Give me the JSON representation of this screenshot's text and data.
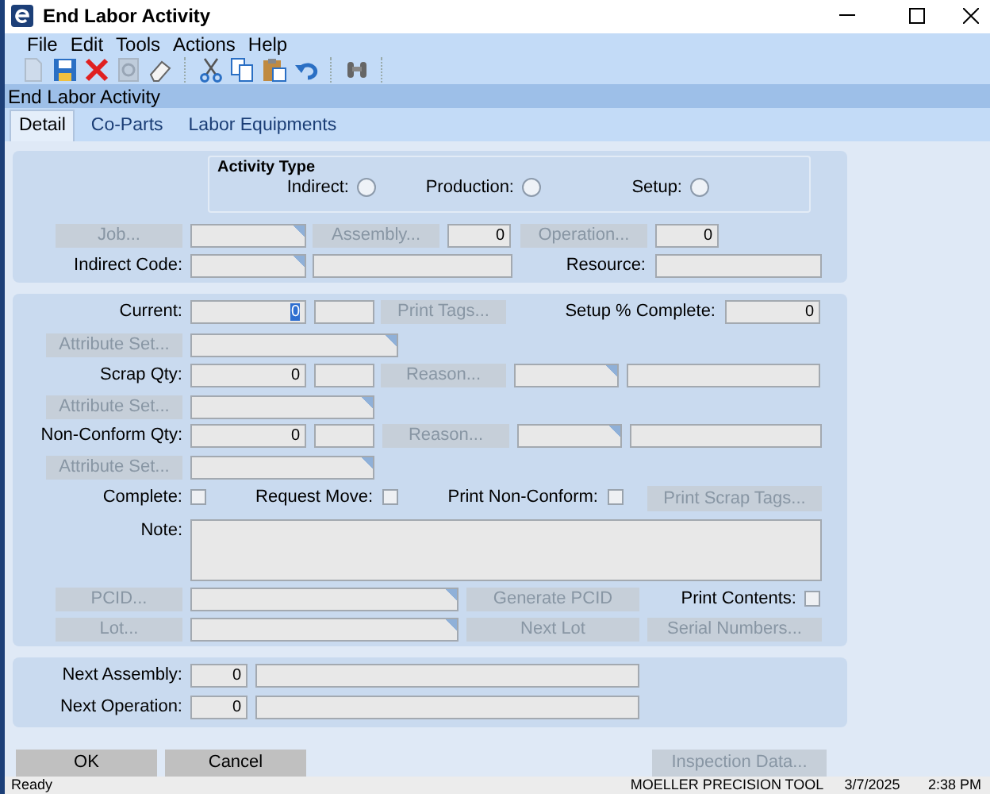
{
  "window": {
    "title": "End Labor Activity"
  },
  "menu": [
    "File",
    "Edit",
    "Tools",
    "Actions",
    "Help"
  ],
  "toolbar": [
    {
      "kind": "new",
      "disabled": true
    },
    {
      "kind": "save",
      "disabled": false
    },
    {
      "kind": "delete",
      "disabled": false
    },
    {
      "kind": "refresh",
      "disabled": true
    },
    {
      "kind": "clear",
      "disabled": false
    },
    {
      "kind": "sep"
    },
    {
      "kind": "cut",
      "disabled": false
    },
    {
      "kind": "copy",
      "disabled": false
    },
    {
      "kind": "paste",
      "disabled": false
    },
    {
      "kind": "undo",
      "disabled": false
    },
    {
      "kind": "sep"
    },
    {
      "kind": "find",
      "disabled": false
    },
    {
      "kind": "sep"
    }
  ],
  "form_title": "End Labor Activity",
  "tabs": [
    {
      "label": "Detail",
      "selected": true
    },
    {
      "label": "Co-Parts",
      "selected": false
    },
    {
      "label": "Labor Equipments",
      "selected": false
    }
  ],
  "activity_type": {
    "title": "Activity Type",
    "options": [
      {
        "label": "Indirect:",
        "selected": false
      },
      {
        "label": "Production:",
        "selected": false
      },
      {
        "label": "Setup:",
        "selected": false
      }
    ]
  },
  "panels": [
    {
      "rows": [
        {
          "items": [
            {
              "kind": "button",
              "label": "Job...",
              "disabled": true
            },
            {
              "kind": "field",
              "value": "",
              "lookup": true
            },
            {
              "kind": "button",
              "label": "Assembly...",
              "disabled": true
            },
            {
              "kind": "field",
              "value": "0",
              "lookup": false
            },
            {
              "kind": "button",
              "label": "Operation...",
              "disabled": true
            },
            {
              "kind": "field",
              "value": "0",
              "lookup": false
            }
          ]
        },
        {
          "items": [
            {
              "kind": "label",
              "label": "Indirect Code:"
            },
            {
              "kind": "field",
              "value": "",
              "lookup": true
            },
            {
              "kind": "field",
              "value": "",
              "lookup": false
            },
            {
              "kind": "label",
              "label": "Resource:"
            },
            {
              "kind": "field",
              "value": "",
              "lookup": false
            }
          ]
        }
      ]
    },
    {
      "rows": [
        {
          "items": [
            {
              "kind": "label",
              "label": "Current:"
            },
            {
              "kind": "field",
              "value": "0",
              "lookup": false,
              "highlighted": true
            },
            {
              "kind": "field",
              "value": "",
              "lookup": false
            },
            {
              "kind": "button",
              "label": "Print Tags...",
              "disabled": true
            },
            {
              "kind": "label",
              "label": "Setup % Complete:"
            },
            {
              "kind": "field",
              "value": "0",
              "lookup": false
            }
          ]
        },
        {
          "items": [
            {
              "kind": "button",
              "label": "Attribute Set...",
              "disabled": true
            },
            {
              "kind": "field",
              "value": "",
              "lookup": true
            }
          ]
        },
        {
          "items": [
            {
              "kind": "label",
              "label": "Scrap Qty:"
            },
            {
              "kind": "field",
              "value": "0",
              "lookup": false
            },
            {
              "kind": "field",
              "value": "",
              "lookup": false
            },
            {
              "kind": "button",
              "label": "Reason...",
              "disabled": true
            },
            {
              "kind": "field",
              "value": "",
              "lookup": true
            },
            {
              "kind": "field",
              "value": "",
              "lookup": false
            }
          ]
        },
        {
          "items": [
            {
              "kind": "button",
              "label": "Attribute Set...",
              "disabled": true
            },
            {
              "kind": "field",
              "value": "",
              "lookup": true
            }
          ]
        },
        {
          "items": [
            {
              "kind": "label",
              "label": "Non-Conform Qty:"
            },
            {
              "kind": "field",
              "value": "0",
              "lookup": false
            },
            {
              "kind": "field",
              "value": "",
              "lookup": false
            },
            {
              "kind": "button",
              "label": "Reason...",
              "disabled": true
            },
            {
              "kind": "field",
              "value": "",
              "lookup": true
            },
            {
              "kind": "field",
              "value": "",
              "lookup": false
            }
          ]
        },
        {
          "items": [
            {
              "kind": "button",
              "label": "Attribute Set...",
              "disabled": true
            },
            {
              "kind": "field",
              "value": "",
              "lookup": true
            }
          ]
        },
        {
          "items": [
            {
              "kind": "label",
              "label": "Complete:"
            },
            {
              "kind": "checkbox",
              "checked": false
            },
            {
              "kind": "label",
              "label": "Request Move:"
            },
            {
              "kind": "checkbox",
              "checked": false
            },
            {
              "kind": "label",
              "label": "Print Non-Conform:"
            },
            {
              "kind": "checkbox",
              "checked": false
            },
            {
              "kind": "button",
              "label": "Print Scrap Tags...",
              "disabled": true
            }
          ]
        },
        {
          "items": [
            {
              "kind": "label",
              "label": "Note:"
            },
            {
              "kind": "note",
              "value": ""
            }
          ]
        },
        {
          "items": [
            {
              "kind": "button",
              "label": "PCID...",
              "disabled": true
            },
            {
              "kind": "field",
              "value": "",
              "lookup": true
            },
            {
              "kind": "button",
              "label": "Generate PCID",
              "disabled": true
            },
            {
              "kind": "label",
              "label": "Print Contents:"
            },
            {
              "kind": "checkbox",
              "checked": false
            }
          ]
        },
        {
          "items": [
            {
              "kind": "button",
              "label": "Lot...",
              "disabled": true
            },
            {
              "kind": "field",
              "value": "",
              "lookup": true
            },
            {
              "kind": "button",
              "label": "Next Lot",
              "disabled": true
            },
            {
              "kind": "button",
              "label": "Serial Numbers...",
              "disabled": true
            }
          ]
        }
      ]
    },
    {
      "rows": [
        {
          "items": [
            {
              "kind": "label",
              "label": "Next Assembly:"
            },
            {
              "kind": "field",
              "value": "0",
              "lookup": false
            },
            {
              "kind": "field",
              "value": "",
              "lookup": false
            }
          ]
        },
        {
          "items": [
            {
              "kind": "label",
              "label": "Next Operation:"
            },
            {
              "kind": "field",
              "value": "0",
              "lookup": false
            },
            {
              "kind": "field",
              "value": "",
              "lookup": false
            }
          ]
        }
      ]
    }
  ],
  "actions": [
    {
      "label": "OK",
      "disabled": false
    },
    {
      "label": "Cancel",
      "disabled": false
    },
    {
      "label": "Inspection Data...",
      "disabled": true
    }
  ],
  "status_bar": {
    "message": "Ready",
    "company": "MOELLER PRECISION TOOL",
    "date": "3/7/2025",
    "time": "2:38 PM"
  }
}
